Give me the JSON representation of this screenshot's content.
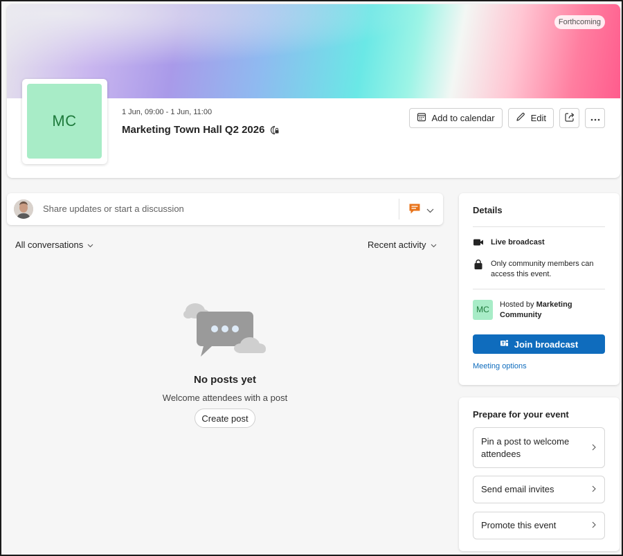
{
  "header": {
    "status_badge": "Forthcoming",
    "avatar_initials": "MC",
    "date_range": "1 Jun, 09:00 - 1 Jun, 11:00",
    "title": "Marketing Town Hall Q2 2026",
    "actions": {
      "add_to_calendar": "Add to calendar",
      "edit": "Edit"
    }
  },
  "compose": {
    "placeholder": "Share updates or start a discussion"
  },
  "filters": {
    "left": "All conversations",
    "right": "Recent activity"
  },
  "empty_state": {
    "title": "No posts yet",
    "subtitle": "Welcome attendees with a post",
    "button": "Create post"
  },
  "details": {
    "title": "Details",
    "broadcast": "Live broadcast",
    "access_line1": "Only community members can",
    "access_line2": "access this event.",
    "host_initials": "MC",
    "hosted_by_prefix": "Hosted by ",
    "host_name_line1": "Marketing",
    "host_name_line2": "Community",
    "join_button": "Join broadcast",
    "meeting_options": "Meeting options"
  },
  "prepare": {
    "title": "Prepare for your event",
    "items": [
      {
        "line1": "Pin a post to welcome",
        "line2": "attendees"
      },
      {
        "line1": "Send email invites",
        "line2": ""
      },
      {
        "line1": "Promote this event",
        "line2": ""
      }
    ]
  },
  "colors": {
    "brand": "#0f6cbd",
    "avatar_bg": "#a8ecc7",
    "avatar_text": "#1e7a3c",
    "compose_icon": "#e8731a"
  }
}
